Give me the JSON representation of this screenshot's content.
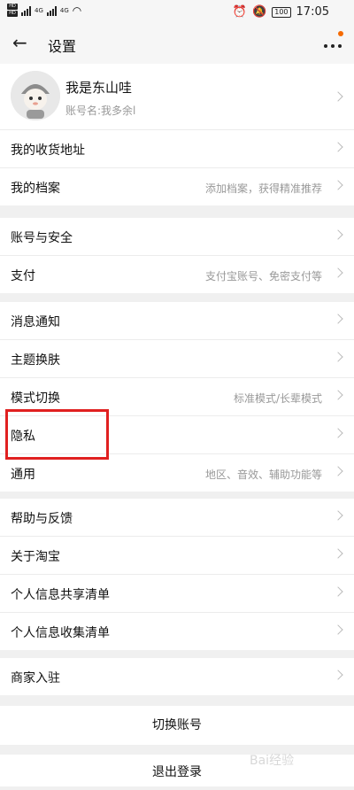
{
  "status_bar": {
    "sim1": "HD",
    "sim2": "HD",
    "net1": "4G",
    "net2": "4G",
    "battery": "100",
    "time": "17:05"
  },
  "nav": {
    "title": "设置"
  },
  "profile": {
    "name": "我是东山哇",
    "account": "账号名:我多余l"
  },
  "groups": [
    [
      {
        "label": "我的收货地址",
        "hint": ""
      },
      {
        "label": "我的档案",
        "hint": "添加档案，获得精准推荐"
      }
    ],
    [
      {
        "label": "账号与安全",
        "hint": ""
      },
      {
        "label": "支付",
        "hint": "支付宝账号、免密支付等"
      }
    ],
    [
      {
        "label": "消息通知",
        "hint": ""
      },
      {
        "label": "主题换肤",
        "hint": ""
      },
      {
        "label": "模式切换",
        "hint": "标准模式/长辈模式"
      },
      {
        "label": "隐私",
        "hint": ""
      },
      {
        "label": "通用",
        "hint": "地区、音效、辅助功能等"
      }
    ],
    [
      {
        "label": "帮助与反馈",
        "hint": ""
      },
      {
        "label": "关于淘宝",
        "hint": ""
      },
      {
        "label": "个人信息共享清单",
        "hint": ""
      },
      {
        "label": "个人信息收集清单",
        "hint": ""
      }
    ],
    [
      {
        "label": "商家入驻",
        "hint": ""
      }
    ]
  ],
  "buttons": {
    "switch_account": "切换账号",
    "logout": "退出登录"
  },
  "watermark": "Bai经验",
  "colors": {
    "highlight": "#e02020",
    "notify_dot": "#f56a00"
  }
}
